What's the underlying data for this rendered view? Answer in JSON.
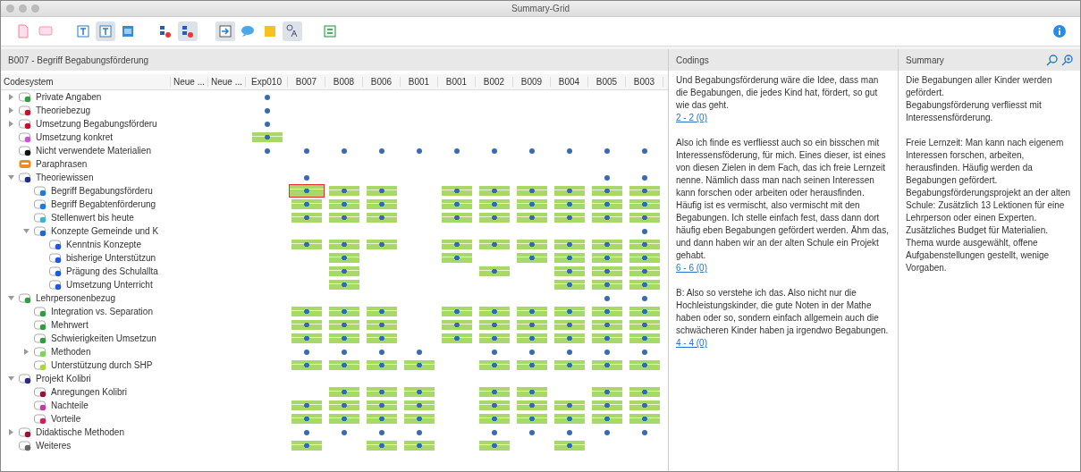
{
  "window": {
    "title": "Summary-Grid"
  },
  "toolbar": [
    {
      "kind": "doc",
      "selected": false
    },
    {
      "kind": "comment",
      "selected": false
    },
    {
      "kind": "text",
      "selected": false
    },
    {
      "kind": "text",
      "selected": true
    },
    {
      "kind": "panel",
      "selected": false
    },
    {
      "kind": "codepin",
      "selected": false
    },
    {
      "kind": "codepin",
      "selected": true
    },
    {
      "kind": "export",
      "selected": true
    },
    {
      "kind": "bubble",
      "selected": false
    },
    {
      "kind": "sticky",
      "selected": false
    },
    {
      "kind": "translate",
      "selected": true
    },
    {
      "kind": "sum",
      "selected": false
    }
  ],
  "grid": {
    "title": "B007 - Begriff Begabungsförderung",
    "first_column": "Codesystem",
    "columns": [
      "Neue ...",
      "Neue ...",
      "Exp010",
      "B007",
      "B008",
      "B006",
      "B001",
      "B001",
      "B002",
      "B009",
      "B004",
      "B005",
      "B003"
    ],
    "tree": [
      {
        "label": "Private Angaben",
        "kind": "code",
        "color": "#2e9e3e",
        "expanded": false,
        "cells": [
          {
            "kind": "none"
          },
          {
            "kind": "none"
          },
          {
            "kind": "dot"
          },
          {
            "kind": "none"
          },
          {
            "kind": "none"
          },
          {
            "kind": "none"
          },
          {
            "kind": "none"
          },
          {
            "kind": "none"
          },
          {
            "kind": "none"
          },
          {
            "kind": "none"
          },
          {
            "kind": "none"
          },
          {
            "kind": "none"
          },
          {
            "kind": "none"
          }
        ]
      },
      {
        "label": "Theoriebezug",
        "kind": "code",
        "color": "#c8102e",
        "expanded": false,
        "cells": [
          {
            "kind": "none"
          },
          {
            "kind": "none"
          },
          {
            "kind": "dot"
          },
          {
            "kind": "none"
          },
          {
            "kind": "none"
          },
          {
            "kind": "none"
          },
          {
            "kind": "none"
          },
          {
            "kind": "none"
          },
          {
            "kind": "none"
          },
          {
            "kind": "none"
          },
          {
            "kind": "none"
          },
          {
            "kind": "none"
          },
          {
            "kind": "none"
          }
        ]
      },
      {
        "label": "Umsetzung Begabungsförderu",
        "kind": "code",
        "color": "#c8102e",
        "expanded": false,
        "cells": [
          {
            "kind": "none"
          },
          {
            "kind": "none"
          },
          {
            "kind": "dot"
          },
          {
            "kind": "none"
          },
          {
            "kind": "none"
          },
          {
            "kind": "none"
          },
          {
            "kind": "none"
          },
          {
            "kind": "none"
          },
          {
            "kind": "none"
          },
          {
            "kind": "none"
          },
          {
            "kind": "none"
          },
          {
            "kind": "none"
          },
          {
            "kind": "none"
          }
        ]
      },
      {
        "label": "Umsetzung konkret",
        "kind": "code",
        "color": "#d04fd8",
        "cells": [
          {
            "kind": "none"
          },
          {
            "kind": "none"
          },
          {
            "kind": "bar"
          },
          {
            "kind": "none"
          },
          {
            "kind": "none"
          },
          {
            "kind": "none"
          },
          {
            "kind": "none"
          },
          {
            "kind": "none"
          },
          {
            "kind": "none"
          },
          {
            "kind": "none"
          },
          {
            "kind": "none"
          },
          {
            "kind": "none"
          },
          {
            "kind": "none"
          }
        ]
      },
      {
        "label": "Nicht verwendete Materialien",
        "kind": "code",
        "color": "#111111",
        "cells": [
          {
            "kind": "none"
          },
          {
            "kind": "none"
          },
          {
            "kind": "dot"
          },
          {
            "kind": "dot"
          },
          {
            "kind": "dot"
          },
          {
            "kind": "dot"
          },
          {
            "kind": "dot"
          },
          {
            "kind": "dot"
          },
          {
            "kind": "dot"
          },
          {
            "kind": "dot"
          },
          {
            "kind": "dot"
          },
          {
            "kind": "dot"
          },
          {
            "kind": "dot"
          }
        ]
      },
      {
        "label": "Paraphrasen",
        "kind": "paraphrase",
        "color": "#f08a24",
        "cells": [
          {
            "kind": "none"
          },
          {
            "kind": "none"
          },
          {
            "kind": "none"
          },
          {
            "kind": "none"
          },
          {
            "kind": "none"
          },
          {
            "kind": "none"
          },
          {
            "kind": "none"
          },
          {
            "kind": "none"
          },
          {
            "kind": "none"
          },
          {
            "kind": "none"
          },
          {
            "kind": "none"
          },
          {
            "kind": "none"
          },
          {
            "kind": "none"
          }
        ]
      },
      {
        "label": "Theoriewissen",
        "kind": "code",
        "color": "#1f2f8f",
        "expanded": true,
        "cells": [
          {
            "kind": "none"
          },
          {
            "kind": "none"
          },
          {
            "kind": "none"
          },
          {
            "kind": "dot"
          },
          {
            "kind": "none"
          },
          {
            "kind": "none"
          },
          {
            "kind": "none"
          },
          {
            "kind": "none"
          },
          {
            "kind": "none"
          },
          {
            "kind": "none"
          },
          {
            "kind": "none"
          },
          {
            "kind": "dot"
          },
          {
            "kind": "dot"
          }
        ],
        "children": [
          {
            "label": "Begriff Begabungsförderu",
            "kind": "code",
            "color": "#1e7ae0",
            "cells": [
              {
                "kind": "none"
              },
              {
                "kind": "none"
              },
              {
                "kind": "none"
              },
              {
                "kind": "selected-bar"
              },
              {
                "kind": "bar"
              },
              {
                "kind": "bar"
              },
              {
                "kind": "none"
              },
              {
                "kind": "bar"
              },
              {
                "kind": "bar"
              },
              {
                "kind": "bar"
              },
              {
                "kind": "bar"
              },
              {
                "kind": "bar"
              },
              {
                "kind": "bar"
              }
            ]
          },
          {
            "label": "Begriff Begabtenförderung",
            "kind": "code",
            "color": "#1e7ae0",
            "cells": [
              {
                "kind": "none"
              },
              {
                "kind": "none"
              },
              {
                "kind": "none"
              },
              {
                "kind": "bar"
              },
              {
                "kind": "bar"
              },
              {
                "kind": "bar"
              },
              {
                "kind": "none"
              },
              {
                "kind": "bar"
              },
              {
                "kind": "bar"
              },
              {
                "kind": "bar"
              },
              {
                "kind": "bar"
              },
              {
                "kind": "bar"
              },
              {
                "kind": "bar"
              }
            ]
          },
          {
            "label": "Stellenwert bis heute",
            "kind": "code",
            "color": "#38b6d8",
            "cells": [
              {
                "kind": "none"
              },
              {
                "kind": "none"
              },
              {
                "kind": "none"
              },
              {
                "kind": "bar"
              },
              {
                "kind": "bar"
              },
              {
                "kind": "bar"
              },
              {
                "kind": "none"
              },
              {
                "kind": "bar"
              },
              {
                "kind": "bar"
              },
              {
                "kind": "bar"
              },
              {
                "kind": "bar"
              },
              {
                "kind": "bar"
              },
              {
                "kind": "bar"
              }
            ]
          },
          {
            "label": "Konzepte Gemeinde und K",
            "kind": "code",
            "color": "#1e6ad0",
            "expanded": true,
            "cells": [
              {
                "kind": "none"
              },
              {
                "kind": "none"
              },
              {
                "kind": "none"
              },
              {
                "kind": "none"
              },
              {
                "kind": "none"
              },
              {
                "kind": "none"
              },
              {
                "kind": "none"
              },
              {
                "kind": "none"
              },
              {
                "kind": "none"
              },
              {
                "kind": "none"
              },
              {
                "kind": "none"
              },
              {
                "kind": "none"
              },
              {
                "kind": "dot"
              }
            ],
            "children": [
              {
                "label": "Kenntnis Konzepte",
                "kind": "code",
                "color": "#1e5ae0",
                "cells": [
                  {
                    "kind": "none"
                  },
                  {
                    "kind": "none"
                  },
                  {
                    "kind": "none"
                  },
                  {
                    "kind": "bar"
                  },
                  {
                    "kind": "bar"
                  },
                  {
                    "kind": "bar"
                  },
                  {
                    "kind": "none"
                  },
                  {
                    "kind": "bar"
                  },
                  {
                    "kind": "bar"
                  },
                  {
                    "kind": "bar"
                  },
                  {
                    "kind": "bar"
                  },
                  {
                    "kind": "bar"
                  },
                  {
                    "kind": "bar"
                  }
                ]
              },
              {
                "label": "bisherige Unterstützun",
                "kind": "code",
                "color": "#1e5ae0",
                "cells": [
                  {
                    "kind": "none"
                  },
                  {
                    "kind": "none"
                  },
                  {
                    "kind": "none"
                  },
                  {
                    "kind": "none"
                  },
                  {
                    "kind": "bar"
                  },
                  {
                    "kind": "none"
                  },
                  {
                    "kind": "none"
                  },
                  {
                    "kind": "bar"
                  },
                  {
                    "kind": "none"
                  },
                  {
                    "kind": "bar"
                  },
                  {
                    "kind": "bar"
                  },
                  {
                    "kind": "bar"
                  },
                  {
                    "kind": "bar"
                  }
                ]
              },
              {
                "label": "Prägung des Schulallta",
                "kind": "code",
                "color": "#1e5ae0",
                "cells": [
                  {
                    "kind": "none"
                  },
                  {
                    "kind": "none"
                  },
                  {
                    "kind": "none"
                  },
                  {
                    "kind": "none"
                  },
                  {
                    "kind": "bar"
                  },
                  {
                    "kind": "none"
                  },
                  {
                    "kind": "none"
                  },
                  {
                    "kind": "none"
                  },
                  {
                    "kind": "bar"
                  },
                  {
                    "kind": "none"
                  },
                  {
                    "kind": "bar"
                  },
                  {
                    "kind": "bar"
                  },
                  {
                    "kind": "bar"
                  }
                ]
              },
              {
                "label": "Umsetzung Unterricht",
                "kind": "code",
                "color": "#1e5ae0",
                "cells": [
                  {
                    "kind": "none"
                  },
                  {
                    "kind": "none"
                  },
                  {
                    "kind": "none"
                  },
                  {
                    "kind": "none"
                  },
                  {
                    "kind": "bar"
                  },
                  {
                    "kind": "none"
                  },
                  {
                    "kind": "none"
                  },
                  {
                    "kind": "none"
                  },
                  {
                    "kind": "none"
                  },
                  {
                    "kind": "none"
                  },
                  {
                    "kind": "bar"
                  },
                  {
                    "kind": "bar"
                  },
                  {
                    "kind": "bar"
                  }
                ]
              }
            ]
          }
        ]
      },
      {
        "label": "Lehrpersonenbezug",
        "kind": "code",
        "color": "#2e9e3e",
        "expanded": true,
        "cells": [
          {
            "kind": "none"
          },
          {
            "kind": "none"
          },
          {
            "kind": "none"
          },
          {
            "kind": "none"
          },
          {
            "kind": "none"
          },
          {
            "kind": "none"
          },
          {
            "kind": "none"
          },
          {
            "kind": "none"
          },
          {
            "kind": "none"
          },
          {
            "kind": "none"
          },
          {
            "kind": "none"
          },
          {
            "kind": "dot"
          },
          {
            "kind": "dot"
          }
        ],
        "children": [
          {
            "label": "Integration vs. Separation",
            "kind": "code",
            "color": "#2e9e3e",
            "cells": [
              {
                "kind": "none"
              },
              {
                "kind": "none"
              },
              {
                "kind": "none"
              },
              {
                "kind": "bar"
              },
              {
                "kind": "bar"
              },
              {
                "kind": "bar"
              },
              {
                "kind": "none"
              },
              {
                "kind": "bar"
              },
              {
                "kind": "bar"
              },
              {
                "kind": "bar"
              },
              {
                "kind": "bar"
              },
              {
                "kind": "bar"
              },
              {
                "kind": "bar"
              }
            ]
          },
          {
            "label": "Mehrwert",
            "kind": "code",
            "color": "#2e9e3e",
            "cells": [
              {
                "kind": "none"
              },
              {
                "kind": "none"
              },
              {
                "kind": "none"
              },
              {
                "kind": "bar"
              },
              {
                "kind": "bar"
              },
              {
                "kind": "bar"
              },
              {
                "kind": "none"
              },
              {
                "kind": "bar"
              },
              {
                "kind": "bar"
              },
              {
                "kind": "bar"
              },
              {
                "kind": "bar"
              },
              {
                "kind": "bar"
              },
              {
                "kind": "bar"
              }
            ]
          },
          {
            "label": "Schwierigkeiten Umsetzun",
            "kind": "code",
            "color": "#2e9e3e",
            "cells": [
              {
                "kind": "none"
              },
              {
                "kind": "none"
              },
              {
                "kind": "none"
              },
              {
                "kind": "bar"
              },
              {
                "kind": "bar"
              },
              {
                "kind": "bar"
              },
              {
                "kind": "none"
              },
              {
                "kind": "bar"
              },
              {
                "kind": "bar"
              },
              {
                "kind": "bar"
              },
              {
                "kind": "bar"
              },
              {
                "kind": "bar"
              },
              {
                "kind": "bar"
              }
            ]
          },
          {
            "label": "Methoden",
            "kind": "code",
            "color": "#7ad858",
            "expanded": false,
            "cells": [
              {
                "kind": "none"
              },
              {
                "kind": "none"
              },
              {
                "kind": "none"
              },
              {
                "kind": "dot"
              },
              {
                "kind": "dot"
              },
              {
                "kind": "dot"
              },
              {
                "kind": "dot"
              },
              {
                "kind": "none"
              },
              {
                "kind": "dot"
              },
              {
                "kind": "dot"
              },
              {
                "kind": "dot"
              },
              {
                "kind": "dot"
              },
              {
                "kind": "dot"
              }
            ]
          },
          {
            "label": "Unterstützung durch SHP",
            "kind": "code",
            "color": "#a8d838",
            "cells": [
              {
                "kind": "none"
              },
              {
                "kind": "none"
              },
              {
                "kind": "none"
              },
              {
                "kind": "bar"
              },
              {
                "kind": "bar"
              },
              {
                "kind": "bar"
              },
              {
                "kind": "bar"
              },
              {
                "kind": "none"
              },
              {
                "kind": "bar"
              },
              {
                "kind": "bar"
              },
              {
                "kind": "bar"
              },
              {
                "kind": "bar"
              },
              {
                "kind": "bar"
              }
            ]
          }
        ]
      },
      {
        "label": "Projekt Kolibri",
        "kind": "code",
        "color": "#2a2a8a",
        "expanded": true,
        "cells": [
          {
            "kind": "none"
          },
          {
            "kind": "none"
          },
          {
            "kind": "none"
          },
          {
            "kind": "none"
          },
          {
            "kind": "none"
          },
          {
            "kind": "none"
          },
          {
            "kind": "none"
          },
          {
            "kind": "none"
          },
          {
            "kind": "none"
          },
          {
            "kind": "none"
          },
          {
            "kind": "none"
          },
          {
            "kind": "none"
          },
          {
            "kind": "none"
          }
        ],
        "children": [
          {
            "label": "Anregungen Kolibri",
            "kind": "code",
            "color": "#a0102e",
            "cells": [
              {
                "kind": "none"
              },
              {
                "kind": "none"
              },
              {
                "kind": "none"
              },
              {
                "kind": "none"
              },
              {
                "kind": "bar"
              },
              {
                "kind": "bar"
              },
              {
                "kind": "bar"
              },
              {
                "kind": "none"
              },
              {
                "kind": "bar"
              },
              {
                "kind": "bar"
              },
              {
                "kind": "none"
              },
              {
                "kind": "bar"
              },
              {
                "kind": "bar"
              }
            ]
          },
          {
            "label": "Nachteile",
            "kind": "code",
            "color": "#c83a9e",
            "cells": [
              {
                "kind": "none"
              },
              {
                "kind": "none"
              },
              {
                "kind": "none"
              },
              {
                "kind": "bar"
              },
              {
                "kind": "bar"
              },
              {
                "kind": "bar"
              },
              {
                "kind": "bar"
              },
              {
                "kind": "none"
              },
              {
                "kind": "bar"
              },
              {
                "kind": "bar"
              },
              {
                "kind": "bar"
              },
              {
                "kind": "bar"
              },
              {
                "kind": "bar"
              }
            ]
          },
          {
            "label": "Vorteile",
            "kind": "code",
            "color": "#d02060",
            "cells": [
              {
                "kind": "none"
              },
              {
                "kind": "none"
              },
              {
                "kind": "none"
              },
              {
                "kind": "bar"
              },
              {
                "kind": "bar"
              },
              {
                "kind": "bar"
              },
              {
                "kind": "bar"
              },
              {
                "kind": "none"
              },
              {
                "kind": "bar"
              },
              {
                "kind": "bar"
              },
              {
                "kind": "bar"
              },
              {
                "kind": "bar"
              },
              {
                "kind": "bar"
              }
            ]
          }
        ]
      },
      {
        "label": "Didaktische Methoden",
        "kind": "code",
        "color": "#a0102e",
        "expanded": false,
        "cells": [
          {
            "kind": "none"
          },
          {
            "kind": "none"
          },
          {
            "kind": "none"
          },
          {
            "kind": "dot"
          },
          {
            "kind": "dot"
          },
          {
            "kind": "dot"
          },
          {
            "kind": "dot"
          },
          {
            "kind": "none"
          },
          {
            "kind": "dot"
          },
          {
            "kind": "dot"
          },
          {
            "kind": "dot"
          },
          {
            "kind": "dot"
          },
          {
            "kind": "dot"
          }
        ]
      },
      {
        "label": "Weiteres",
        "kind": "code",
        "color": "#666666",
        "cells": [
          {
            "kind": "none"
          },
          {
            "kind": "none"
          },
          {
            "kind": "none"
          },
          {
            "kind": "bar"
          },
          {
            "kind": "none"
          },
          {
            "kind": "bar"
          },
          {
            "kind": "bar"
          },
          {
            "kind": "none"
          },
          {
            "kind": "bar"
          },
          {
            "kind": "none"
          },
          {
            "kind": "bar"
          },
          {
            "kind": "none"
          },
          {
            "kind": "none"
          }
        ]
      }
    ]
  },
  "codings": {
    "title": "Codings",
    "entries": [
      {
        "text": "Und Begabungsförderung wäre die Idee, dass man die Begabungen, die jedes Kind hat, fördert, so gut wie das geht.",
        "link": "2 - 2  (0)"
      },
      {
        "text": "Also ich finde es verfliesst auch so ein bisschen mit Interessensföderung, für mich. Eines dieser, ist eines von diesen Zielen in dem Fach, das ich freie Lernzeit nenne. Nämlich dass man nach seinen Interessen kann forschen oder arbeiten oder herausfinden. Häufig ist es vermischt, also vermischt mit den Begabungen. Ich stelle einfach fest, dass dann dort häufig eben Begabungen gefördert werden. Ähm das, und dann haben wir an der alten Schule ein Projekt gehabt.",
        "link": "6 - 6  (0)"
      },
      {
        "text": "B: Also so verstehe ich das. Also nicht nur die Hochleistungskinder, die gute Noten in der Mathe haben oder so, sondern einfach allgemein auch die schwächeren Kinder haben ja irgendwo Begabungen.",
        "link": "4 - 4  (0)"
      }
    ]
  },
  "summary": {
    "title": "Summary",
    "paragraphs": [
      [
        "Die Begabungen aller Kinder werden gefördert.",
        "Begabungsförderung verfliesst mit Interessensförderung."
      ],
      [
        "Freie Lernzeit: Man kann nach eigenem Interessen forschen, arbeiten, herausfinden. Häufig werden da Begabungen gefördert.",
        "Begabungsförderungsprojekt an der alten Schule: Zusätzlich 13 Lektionen für eine Lehrperson oder einen Experten. Zusätzliches Budget für Materialien. Thema wurde ausgewählt, offene Aufgabenstellungen gestellt, wenige Vorgaben."
      ]
    ]
  }
}
